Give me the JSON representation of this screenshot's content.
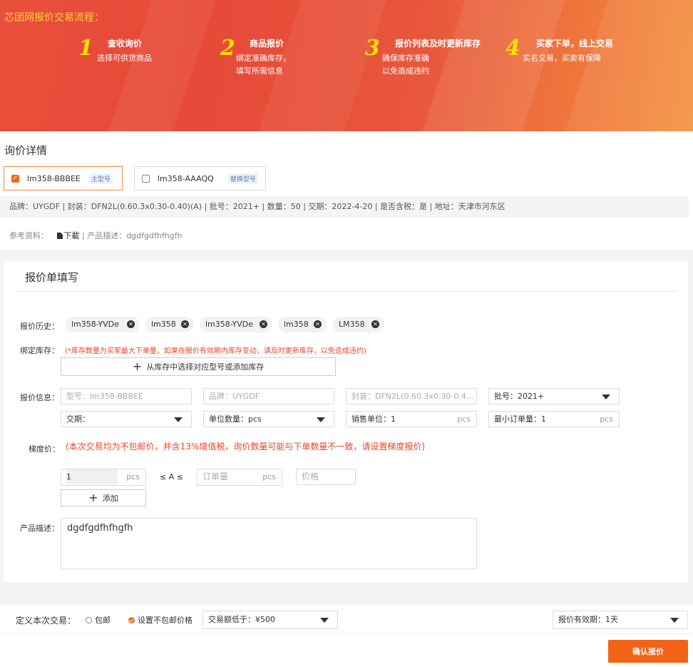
{
  "banner": {
    "title": "芯团网报价交易流程：",
    "steps": [
      {
        "num": "1",
        "title": "查收询价",
        "lines": [
          "选择可供货商品"
        ]
      },
      {
        "num": "2",
        "title": "商品报价",
        "lines": [
          "绑定准确库存，",
          "填写所需信息"
        ]
      },
      {
        "num": "3",
        "title": "报价列表及时更新库存",
        "lines": [
          "确保库存准确",
          "以免造成违约"
        ]
      },
      {
        "num": "4",
        "title": "买家下单，线上交易",
        "lines": [
          "实名交易，买卖有保障"
        ]
      }
    ]
  },
  "detail": {
    "title": "询价详情",
    "models": [
      {
        "name": "lm358-BBBEE",
        "tag": "主型号",
        "checked": true
      },
      {
        "name": "lm358-AAAQQ",
        "tag": "替换型号",
        "checked": false
      }
    ],
    "info": "品牌：UYGDF | 封装：DFN2L(0.60.3x0.30-0.40)(A) | 批号：2021+ | 数量：50 | 交期：2022-4-20 | 是否含税：是 | 地址：天津市河东区",
    "ref_label": "参考资料：",
    "download": "下載",
    "desc_label": "| 产品描述：dgdfgdfhfhgfh"
  },
  "form": {
    "title": "报价单填写",
    "history_label": "报价历史：",
    "history": [
      "lm358-YVDe",
      "lm358",
      "lm358-YVDe",
      "lm358",
      "LM358"
    ],
    "stock_label": "绑定库存：",
    "stock_warning": "(*库存数量为买家最大下单量，如果在报价有效期内库存变动，请及时更新库存，以免造成违约)",
    "stock_button": "从库存中选择对应型号或添加库存",
    "info_label": "报价信息：",
    "model_placeholder": "型号：lm358-BBBEE",
    "brand_placeholder": "品牌：UYGDF",
    "package_placeholder": "封装：DFN2L(0.60.3x0.30-0.4...",
    "batch": "批号：2021+",
    "delivery": "交期：",
    "unit_qty": "单位数量：pcs",
    "sale_unit_label": "销售单位：",
    "sale_unit_value": "1",
    "min_order_label": "最小订单量：",
    "min_order_value": "1",
    "unit": "pcs",
    "tier_label": "梯度价：",
    "tier_warning": "(本次交易均为不包邮价，并含13%增值税，询价数量可能与下单数量不一致，请设置梯度报价)",
    "tier_min": "1",
    "tier_op": "≤ A ≤",
    "tier_max_placeholder": "订单量",
    "price_placeholder": "价格",
    "add_button": "添加",
    "desc_label": "产品描述：",
    "desc_value": "dgdfgdfhfhgfh"
  },
  "bottom": {
    "define_label": "定义本次交易：",
    "option_free": "包邮",
    "option_nonfree": "设置不包邮价格",
    "amount_select": "交易额低于：¥500",
    "validity_select": "报价有效期：1天",
    "submit": "确认报价"
  },
  "colors": {
    "accent": "#f26217",
    "warning": "#e8452b",
    "banner_yellow": "#ffe100"
  }
}
